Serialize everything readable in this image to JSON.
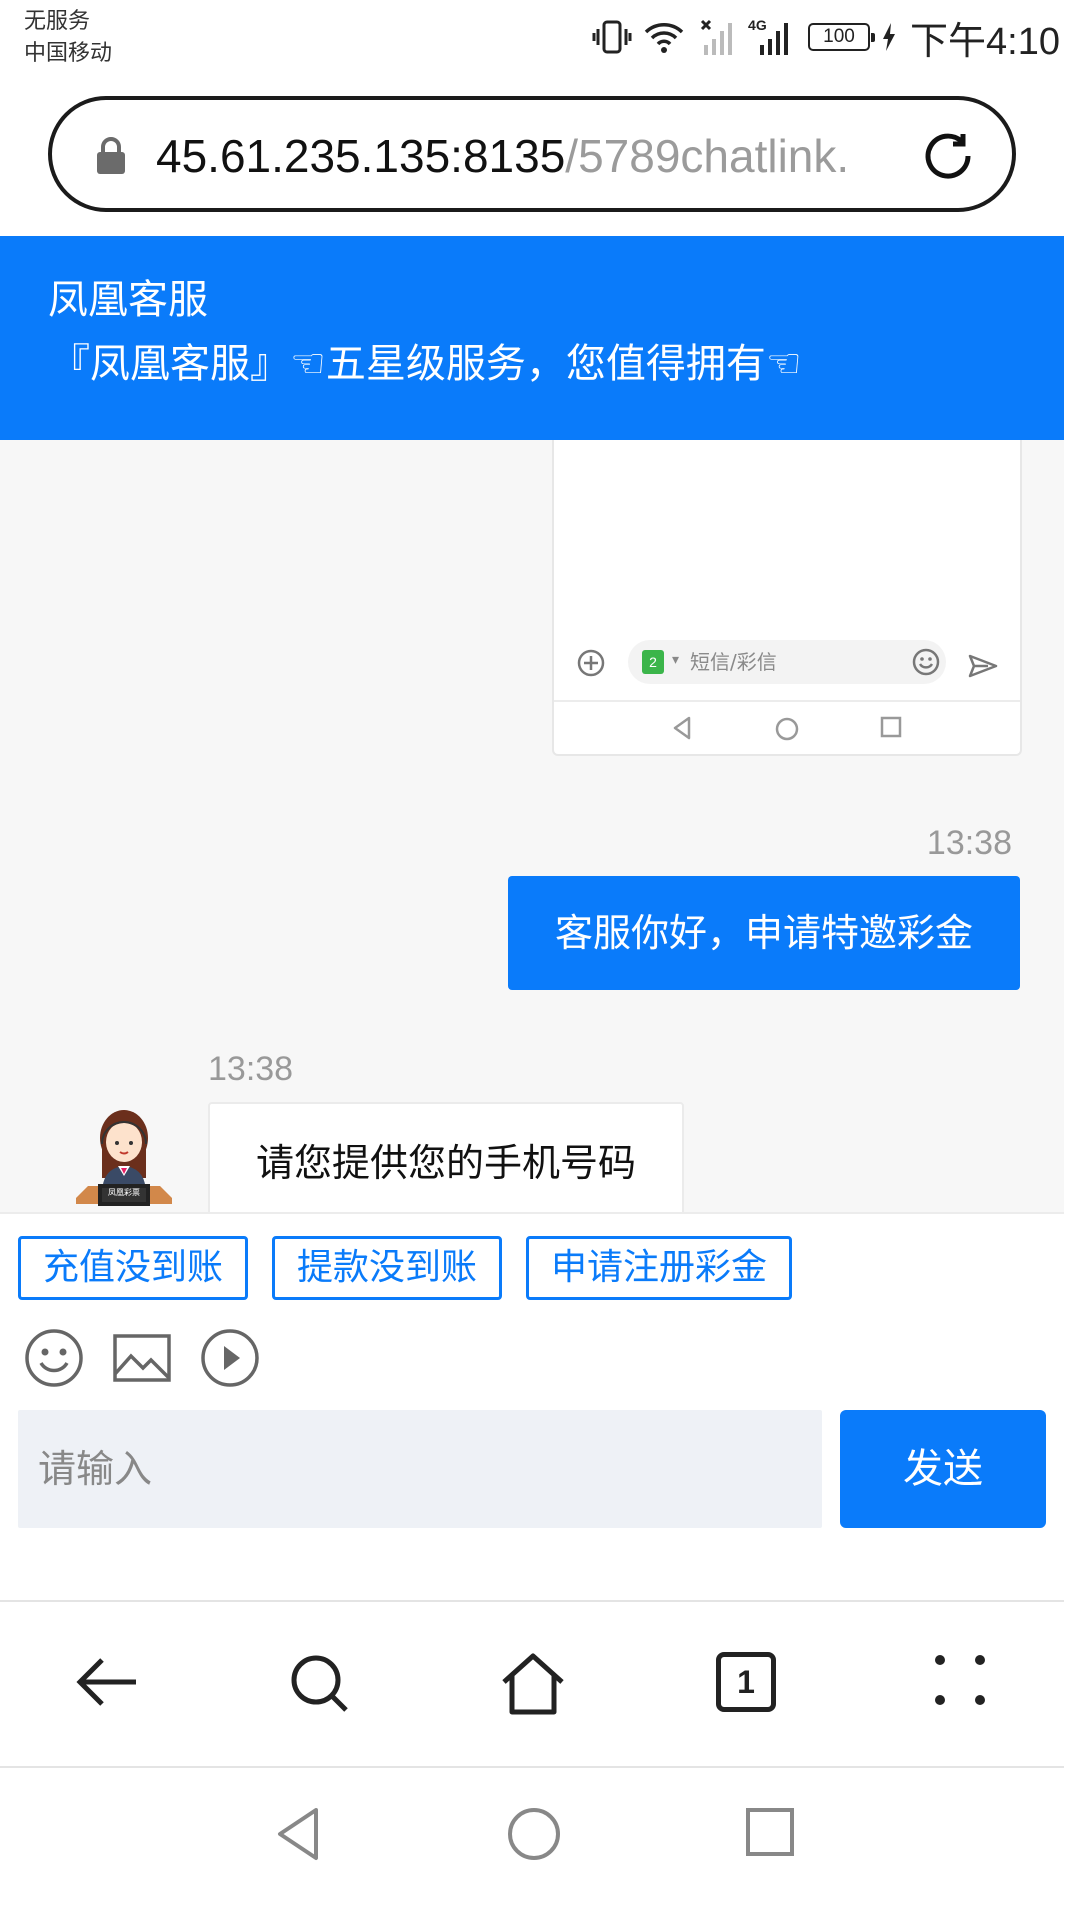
{
  "status_bar": {
    "carrier_line1": "无服务",
    "carrier_line2": "中国移动",
    "network_label": "4G",
    "battery": "100",
    "time": "下午4:10"
  },
  "url_bar": {
    "host": "45.61.235.135:8135",
    "path": "/5789chatlink."
  },
  "chat_header": {
    "title": "凤凰客服",
    "subtitle": "『凤凰客服』☜五星级服务，您值得拥有☜"
  },
  "screenshot_card": {
    "sim_label": "2",
    "input_placeholder": "短信/彩信"
  },
  "messages": [
    {
      "direction": "outgoing",
      "time": "13:38",
      "text": "客服你好，申请特邀彩金"
    },
    {
      "direction": "incoming",
      "time": "13:38",
      "text": "请您提供您的手机号码",
      "avatar_label": "凤凰彩票"
    }
  ],
  "quick_replies": [
    "充值没到账",
    "提款没到账",
    "申请注册彩金"
  ],
  "composer": {
    "placeholder": "请输入",
    "send_label": "发送"
  },
  "browser_toolbar": {
    "tab_count": "1"
  },
  "icons": [
    "lock-icon",
    "reload-icon",
    "emoji-icon",
    "image-icon",
    "video-icon",
    "back-icon",
    "search-icon",
    "home-icon",
    "more-icon"
  ],
  "colors": {
    "accent": "#0a7bfa",
    "chat_background": "#f7f7f7",
    "input_background": "#eef1f6"
  }
}
